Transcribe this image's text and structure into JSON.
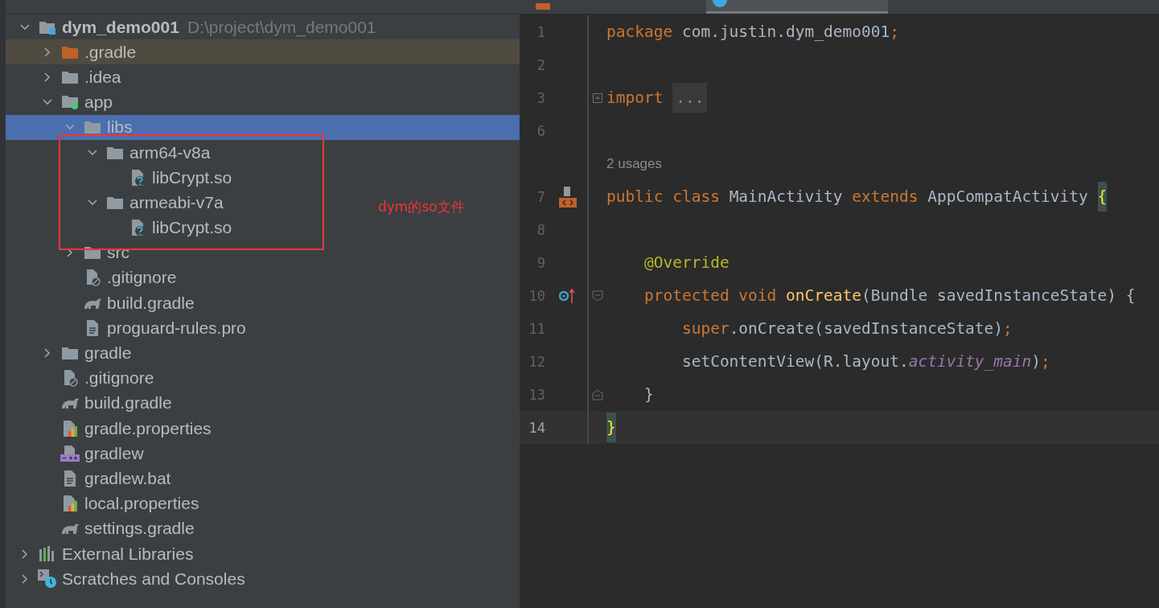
{
  "project_panel": {
    "tree": [
      {
        "name": "dym_demo001",
        "path": "D:\\project\\dym_demo001",
        "kind": "module",
        "expanded": true,
        "selected": false,
        "children": [
          {
            "name": ".gradle",
            "kind": "excluded-folder",
            "expanded": false,
            "selected": false
          },
          {
            "name": ".idea",
            "kind": "folder",
            "expanded": false,
            "selected": false
          },
          {
            "name": "app",
            "kind": "android-module",
            "expanded": true,
            "selected": false,
            "children": [
              {
                "name": "libs",
                "kind": "folder",
                "expanded": true,
                "selected": true,
                "children": [
                  {
                    "name": "arm64-v8a",
                    "kind": "folder",
                    "expanded": true,
                    "selected": false,
                    "children": [
                      {
                        "name": "libCrypt.so",
                        "kind": "unknown-file",
                        "selected": false
                      }
                    ]
                  },
                  {
                    "name": "armeabi-v7a",
                    "kind": "folder",
                    "expanded": true,
                    "selected": false,
                    "children": [
                      {
                        "name": "libCrypt.so",
                        "kind": "unknown-file",
                        "selected": false
                      }
                    ]
                  }
                ]
              },
              {
                "name": "src",
                "kind": "folder",
                "expanded": false,
                "selected": false
              },
              {
                "name": ".gitignore",
                "kind": "gitignore",
                "selected": false
              },
              {
                "name": "build.gradle",
                "kind": "gradle",
                "selected": false
              },
              {
                "name": "proguard-rules.pro",
                "kind": "text",
                "selected": false
              }
            ]
          },
          {
            "name": "gradle",
            "kind": "folder",
            "expanded": false,
            "selected": false
          },
          {
            "name": ".gitignore",
            "kind": "gitignore",
            "selected": false
          },
          {
            "name": "build.gradle",
            "kind": "gradle",
            "selected": false
          },
          {
            "name": "gradle.properties",
            "kind": "properties",
            "selected": false
          },
          {
            "name": "gradlew",
            "kind": "shell",
            "selected": false
          },
          {
            "name": "gradlew.bat",
            "kind": "text",
            "selected": false
          },
          {
            "name": "local.properties",
            "kind": "properties",
            "selected": false
          },
          {
            "name": "settings.gradle",
            "kind": "gradle",
            "selected": false
          }
        ]
      },
      {
        "name": "External Libraries",
        "kind": "libraries",
        "expanded": false,
        "selected": false
      },
      {
        "name": "Scratches and Consoles",
        "kind": "scratches",
        "expanded": false,
        "selected": false
      }
    ],
    "annotation": {
      "text": "dym的so文件"
    }
  },
  "editor": {
    "tabs": [
      {
        "kind": "xml",
        "selected": false
      },
      {
        "kind": "java",
        "selected": true
      }
    ],
    "lines": [
      {
        "kind": "code",
        "number": "1",
        "tokens": [
          {
            "kind": "keyword",
            "text": "package "
          },
          {
            "kind": "plain",
            "text": "com.justin.dym_demo001"
          },
          {
            "kind": "keyword",
            "text": ";"
          }
        ]
      },
      {
        "kind": "code",
        "number": "2"
      },
      {
        "kind": "code",
        "number": "3",
        "fold": {
          "kind": "collapsed"
        },
        "tokens": [
          {
            "kind": "keyword",
            "text": "import "
          },
          {
            "kind": "folded",
            "text": "..."
          }
        ]
      },
      {
        "kind": "code",
        "number": "6"
      },
      {
        "kind": "inlay",
        "text": "2 usages"
      },
      {
        "kind": "code",
        "number": "7",
        "gutter": {
          "kind": "layout"
        },
        "tokens": [
          {
            "kind": "keyword",
            "text": "public class "
          },
          {
            "kind": "plain",
            "text": "MainActivity "
          },
          {
            "kind": "keyword",
            "text": "extends "
          },
          {
            "kind": "plain",
            "text": "AppCompatActivity "
          },
          {
            "kind": "matched-brace",
            "text": "{"
          }
        ]
      },
      {
        "kind": "code",
        "number": "8"
      },
      {
        "kind": "code",
        "number": "9",
        "tokens": [
          {
            "kind": "annotation",
            "text": "    @Override"
          }
        ]
      },
      {
        "kind": "code",
        "number": "10",
        "gutter": {
          "kind": "override"
        },
        "fold": {
          "kind": "start"
        },
        "tokens": [
          {
            "kind": "keyword",
            "text": "    protected void "
          },
          {
            "kind": "method",
            "text": "onCreate"
          },
          {
            "kind": "plain",
            "text": "(Bundle savedInstanceState) {"
          }
        ]
      },
      {
        "kind": "code",
        "number": "11",
        "tokens": [
          {
            "kind": "keyword",
            "text": "        super"
          },
          {
            "kind": "plain",
            "text": ".onCreate(savedInstanceState)"
          },
          {
            "kind": "keyword",
            "text": ";"
          }
        ]
      },
      {
        "kind": "code",
        "number": "12",
        "tokens": [
          {
            "kind": "plain",
            "text": "        setContentView(R.layout."
          },
          {
            "kind": "constant",
            "text": "activity_main"
          },
          {
            "kind": "plain",
            "text": ")"
          },
          {
            "kind": "keyword",
            "text": ";"
          }
        ]
      },
      {
        "kind": "code",
        "number": "13",
        "fold": {
          "kind": "end"
        },
        "tokens": [
          {
            "kind": "plain",
            "text": "    }"
          }
        ]
      },
      {
        "kind": "code",
        "number": "14",
        "current": true,
        "tokens": [
          {
            "kind": "matched-brace",
            "text": "}"
          }
        ]
      }
    ]
  }
}
